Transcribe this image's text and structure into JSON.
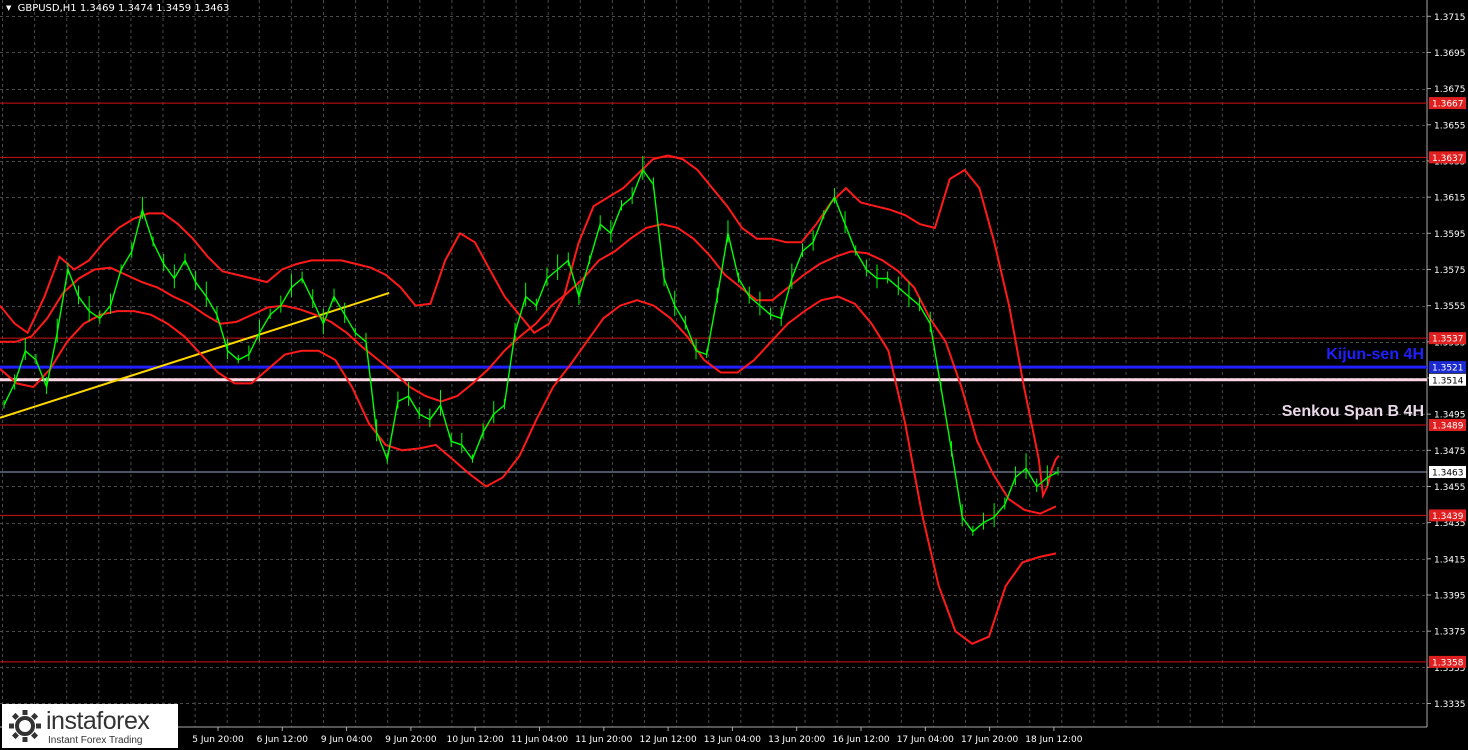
{
  "header": {
    "symbol": "GBPUSD,H1",
    "ohlc": "1.3469 1.3474 1.3459 1.3463"
  },
  "annotations": {
    "kijun": "Kijun-sen 4H",
    "senkou": "Senkou Span B 4H"
  },
  "watermark": {
    "name": "instaforex",
    "tagline": "Instant Forex Trading"
  },
  "colors": {
    "background": "#000000",
    "grid": "#4a4a4a",
    "price": "#00ff00",
    "bands": "#ff1a1a",
    "levels": "#d01010",
    "kijun": "#1f1fff",
    "senkou": "#ffd6e6",
    "trendline": "#ffd700",
    "current": "#9aa8c8"
  },
  "chart_data": {
    "type": "line",
    "symbol": "GBPUSD",
    "timeframe": "H1",
    "ylim": [
      1.3322,
      1.3724
    ],
    "y_ticks": [
      "1.3715",
      "1.3695",
      "1.3675",
      "1.3655",
      "1.3635",
      "1.3615",
      "1.3595",
      "1.3575",
      "1.3555",
      "1.3535",
      "1.3515",
      "1.3495",
      "1.3475",
      "1.3455",
      "1.3435",
      "1.3415",
      "1.3395",
      "1.3375",
      "1.3355",
      "1.3335"
    ],
    "x_tick_labels": [
      "5 Jun 20:00",
      "6 Jun 12:00",
      "9 Jun 04:00",
      "9 Jun 20:00",
      "10 Jun 12:00",
      "11 Jun 04:00",
      "11 Jun 20:00",
      "12 Jun 12:00",
      "13 Jun 04:00",
      "13 Jun 20:00",
      "16 Jun 12:00",
      "17 Jun 04:00",
      "17 Jun 20:00",
      "18 Jun 12:00"
    ],
    "horizontal_levels": [
      {
        "value": 1.3667,
        "label": "1.3667",
        "kind": "resistance"
      },
      {
        "value": 1.3637,
        "label": "1.3637",
        "kind": "resistance"
      },
      {
        "value": 1.3537,
        "label": "1.3537",
        "kind": "resistance"
      },
      {
        "value": 1.3521,
        "label": "1.3521",
        "kind": "kijun"
      },
      {
        "value": 1.3514,
        "label": "1.3514",
        "kind": "senkou"
      },
      {
        "value": 1.3489,
        "label": "1.3489",
        "kind": "resistance"
      },
      {
        "value": 1.3463,
        "label": "1.3463",
        "kind": "current"
      },
      {
        "value": 1.3439,
        "label": "1.3439",
        "kind": "support"
      },
      {
        "value": 1.3358,
        "label": "1.3358",
        "kind": "support"
      }
    ],
    "price_series": [
      1.35,
      1.3512,
      1.353,
      1.3525,
      1.351,
      1.354,
      1.3575,
      1.356,
      1.3552,
      1.3548,
      1.3555,
      1.3575,
      1.3585,
      1.3608,
      1.359,
      1.3578,
      1.357,
      1.358,
      1.3568,
      1.356,
      1.355,
      1.353,
      1.3525,
      1.3528,
      1.354,
      1.355,
      1.3555,
      1.3565,
      1.357,
      1.3558,
      1.3545,
      1.356,
      1.355,
      1.354,
      1.3535,
      1.3485,
      1.347,
      1.3502,
      1.3505,
      1.3495,
      1.3492,
      1.35,
      1.348,
      1.3478,
      1.347,
      1.3485,
      1.3495,
      1.35,
      1.354,
      1.356,
      1.3555,
      1.357,
      1.3575,
      1.358,
      1.356,
      1.358,
      1.36,
      1.3595,
      1.361,
      1.3615,
      1.363,
      1.3622,
      1.357,
      1.3555,
      1.3545,
      1.353,
      1.3528,
      1.356,
      1.3595,
      1.357,
      1.356,
      1.3555,
      1.355,
      1.3548,
      1.357,
      1.3585,
      1.359,
      1.3605,
      1.3615,
      1.36,
      1.3585,
      1.3575,
      1.357,
      1.357,
      1.3565,
      1.356,
      1.3555,
      1.3545,
      1.351,
      1.3475,
      1.3438,
      1.343,
      1.3435,
      1.3438,
      1.3445,
      1.346,
      1.3465,
      1.3455,
      1.346,
      1.3463
    ],
    "upper_band": [
      1.3555,
      1.3545,
      1.354,
      1.356,
      1.3582,
      1.3575,
      1.358,
      1.359,
      1.3598,
      1.3603,
      1.3606,
      1.3606,
      1.36,
      1.3592,
      1.3582,
      1.3574,
      1.3572,
      1.357,
      1.3568,
      1.3575,
      1.3578,
      1.358,
      1.358,
      1.358,
      1.3578,
      1.3576,
      1.3572,
      1.3565,
      1.3555,
      1.3556,
      1.358,
      1.3595,
      1.359,
      1.3575,
      1.356,
      1.355,
      1.354,
      1.3545,
      1.356,
      1.359,
      1.361,
      1.3615,
      1.362,
      1.3628,
      1.3636,
      1.3638,
      1.3636,
      1.363,
      1.362,
      1.361,
      1.3598,
      1.3592,
      1.3592,
      1.359,
      1.359,
      1.36,
      1.3612,
      1.362,
      1.3612,
      1.361,
      1.3608,
      1.3605,
      1.36,
      1.3598,
      1.3625,
      1.363,
      1.362,
      1.359,
      1.3555,
      1.351,
      1.347,
      1.345,
      1.3455,
      1.3464,
      1.347,
      1.3472
    ],
    "upper_band_x": [
      0,
      14,
      26,
      42,
      56,
      70,
      84,
      98,
      112,
      126,
      140,
      154,
      168,
      182,
      196,
      210,
      224,
      238,
      252,
      266,
      280,
      294,
      308,
      322,
      336,
      350,
      364,
      378,
      392,
      406,
      420,
      434,
      448,
      462,
      476,
      490,
      504,
      518,
      532,
      546,
      560,
      574,
      588,
      602,
      616,
      630,
      644,
      658,
      672,
      686,
      700,
      714,
      728,
      742,
      756,
      770,
      784,
      798,
      812,
      826,
      840,
      854,
      868,
      882,
      896,
      910,
      924,
      938,
      952,
      966,
      980,
      984,
      988,
      992,
      996,
      999
    ],
    "mid_band": [
      1.3535,
      1.3535,
      1.3538,
      1.3548,
      1.3562,
      1.357,
      1.3575,
      1.3576,
      1.3572,
      1.3568,
      1.3565,
      1.356,
      1.3556,
      1.355,
      1.3545,
      1.3546,
      1.355,
      1.3554,
      1.3555,
      1.3553,
      1.355,
      1.3546,
      1.354,
      1.3532,
      1.3525,
      1.3518,
      1.351,
      1.3505,
      1.3502,
      1.3505,
      1.3512,
      1.352,
      1.353,
      1.3538,
      1.3545,
      1.3555,
      1.3562,
      1.357,
      1.358,
      1.3585,
      1.3592,
      1.3598,
      1.36,
      1.3598,
      1.3592,
      1.3583,
      1.3572,
      1.3565,
      1.3558,
      1.3558,
      1.3565,
      1.3572,
      1.3578,
      1.3582,
      1.3585,
      1.3584,
      1.358,
      1.3574,
      1.3565,
      1.3548,
      1.3535,
      1.351,
      1.348,
      1.3462,
      1.3448,
      1.3442,
      1.344,
      1.3444
    ],
    "lower_band": [
      1.352,
      1.3512,
      1.351,
      1.352,
      1.3535,
      1.3545,
      1.355,
      1.3552,
      1.3552,
      1.355,
      1.3545,
      1.3538,
      1.3528,
      1.3518,
      1.3512,
      1.3512,
      1.352,
      1.3528,
      1.353,
      1.353,
      1.3525,
      1.351,
      1.349,
      1.3478,
      1.3475,
      1.3476,
      1.3478,
      1.347,
      1.3462,
      1.3455,
      1.346,
      1.3472,
      1.3492,
      1.351,
      1.3522,
      1.3535,
      1.3548,
      1.3555,
      1.3558,
      1.3555,
      1.3548,
      1.3538,
      1.3525,
      1.3518,
      1.3518,
      1.3525,
      1.3535,
      1.3545,
      1.3552,
      1.3558,
      1.356,
      1.3556,
      1.3545,
      1.353,
      1.349,
      1.344,
      1.34,
      1.3375,
      1.3368,
      1.3372,
      1.34,
      1.3413,
      1.3416,
      1.3418
    ],
    "trendline": [
      {
        "x": 0,
        "y": 1.3493
      },
      {
        "x": 0.2727,
        "y": 1.3562
      }
    ]
  }
}
